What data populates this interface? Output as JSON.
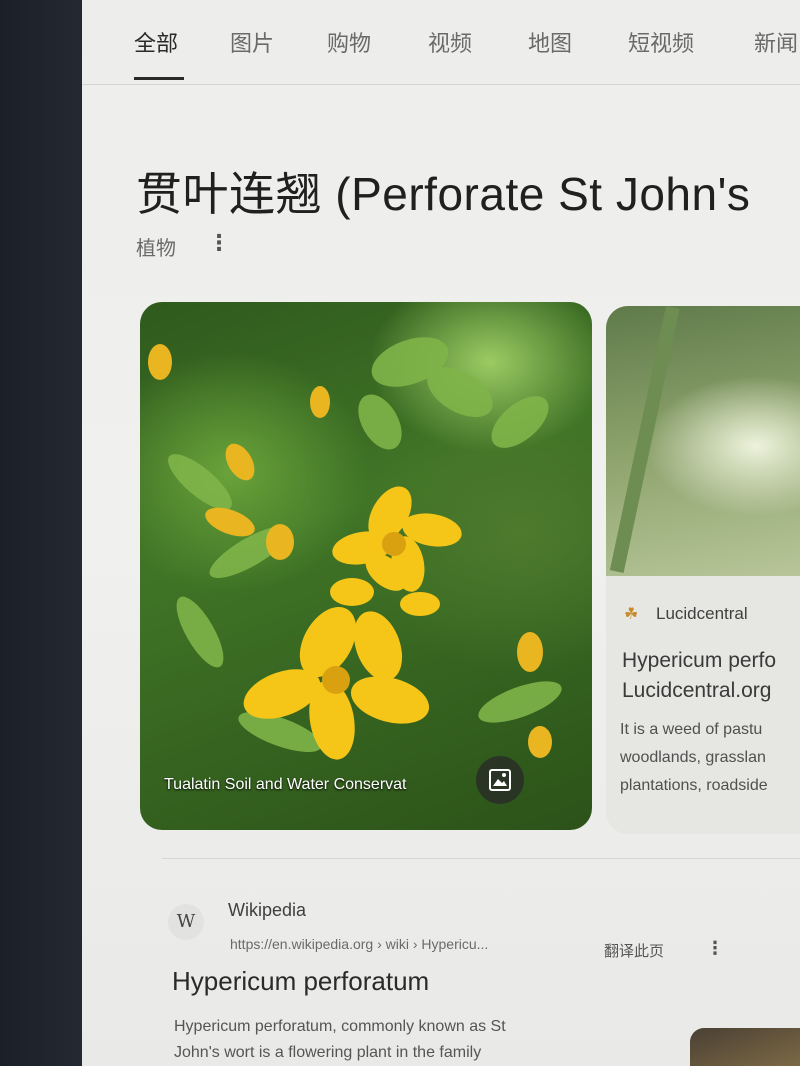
{
  "tabs": [
    {
      "label": "全部",
      "active": true
    },
    {
      "label": "图片"
    },
    {
      "label": "购物"
    },
    {
      "label": "视频"
    },
    {
      "label": "地图"
    },
    {
      "label": "短视频"
    },
    {
      "label": "新闻"
    }
  ],
  "knowledge_panel": {
    "title": "贯叶连翘 (Perforate St John's",
    "subtitle": "植物"
  },
  "image_card": {
    "caption": "Tualatin Soil and Water Conservat",
    "icon": "image-icon"
  },
  "source_card": {
    "source_name": "Lucidcentral",
    "title_lines": [
      "Hypericum perfo",
      "Lucidcentral.org"
    ],
    "text_lines": [
      "It is a weed of pastu",
      "woodlands, grasslan",
      "plantations, roadside"
    ]
  },
  "result": {
    "site": "Wikipedia",
    "logo": "W",
    "url": "https://en.wikipedia.org › wiki › Hypericu...",
    "translate": "翻译此页",
    "title": "Hypericum perforatum",
    "snippet_lines": [
      "Hypericum perforatum, commonly known as St",
      "John's wort is a flowering plant in the family"
    ]
  },
  "colors": {
    "flower": "#f5c518",
    "accent_source_icon": "#c98a2a"
  }
}
